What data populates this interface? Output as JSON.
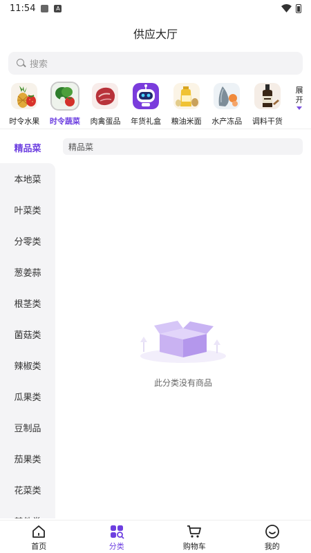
{
  "status_bar": {
    "time": "11:54"
  },
  "header": {
    "title": "供应大厅"
  },
  "search": {
    "placeholder": "搜索"
  },
  "categories": [
    {
      "label": "时令水果",
      "icon": "pineapple-strawberry-icon"
    },
    {
      "label": "时令蔬菜",
      "icon": "vegetables-icon",
      "active": true
    },
    {
      "label": "肉禽蛋品",
      "icon": "meat-icon"
    },
    {
      "label": "年货礼盒",
      "icon": "robot-gift-icon"
    },
    {
      "label": "粮油米面",
      "icon": "oil-bottle-icon"
    },
    {
      "label": "水产冻品",
      "icon": "fish-icon"
    },
    {
      "label": "调料干货",
      "icon": "liquor-bottle-icon"
    }
  ],
  "expand": {
    "label_1": "展",
    "label_2": "开"
  },
  "sidebar": {
    "active": "精品菜",
    "items": [
      "本地菜",
      "叶菜类",
      "分零类",
      "葱姜蒜",
      "根茎类",
      "菌菇类",
      "辣椒类",
      "瓜果类",
      "豆制品",
      "茄果类",
      "花菜类",
      "其他类"
    ]
  },
  "section": {
    "title": "精品菜"
  },
  "empty_state": {
    "message": "此分类没有商品"
  },
  "bottom_nav": [
    {
      "label": "首页",
      "icon": "home-icon"
    },
    {
      "label": "分类",
      "icon": "category-icon",
      "active": true
    },
    {
      "label": "购物车",
      "icon": "cart-icon"
    },
    {
      "label": "我的",
      "icon": "profile-icon"
    }
  ],
  "colors": {
    "accent": "#6d3fe0",
    "background": "#ffffff",
    "panel": "#f4f4f6"
  }
}
